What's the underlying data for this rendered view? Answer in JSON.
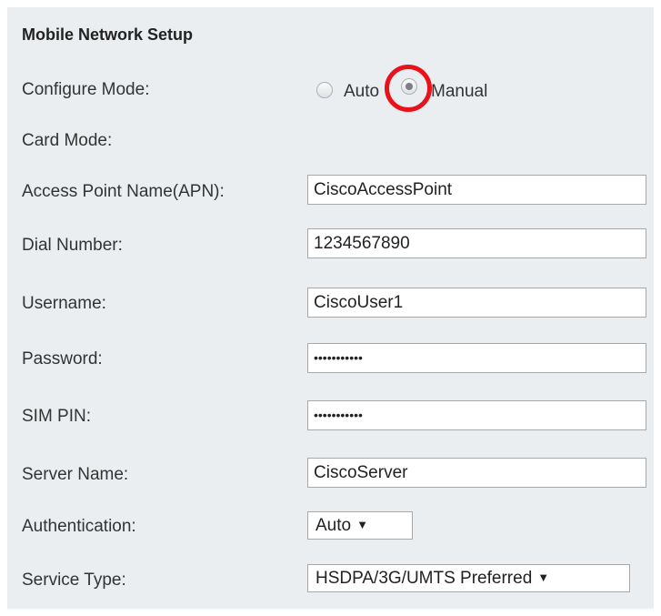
{
  "section_title": "Mobile Network Setup",
  "configure_mode": {
    "label": "Configure Mode:",
    "options": [
      "Auto",
      "Manual"
    ],
    "selected": "Manual"
  },
  "card_mode": {
    "label": "Card Mode:"
  },
  "apn": {
    "label": "Access Point Name(APN):",
    "value": "CiscoAccessPoint"
  },
  "dial_number": {
    "label": "Dial Number:",
    "value": "1234567890"
  },
  "username": {
    "label": "Username:",
    "value": "CiscoUser1"
  },
  "password": {
    "label": "Password:",
    "masked": "•••••••••••"
  },
  "sim_pin": {
    "label": "SIM PIN:",
    "masked": "•••••••••••"
  },
  "server_name": {
    "label": "Server Name:",
    "value": "CiscoServer"
  },
  "authentication": {
    "label": "Authentication:",
    "selected": "Auto"
  },
  "service_type": {
    "label": "Service Type:",
    "selected": "HSDPA/3G/UMTS Preferred"
  },
  "colors": {
    "panel_bg": "#ebeef0",
    "highlight": "#e8121b"
  }
}
